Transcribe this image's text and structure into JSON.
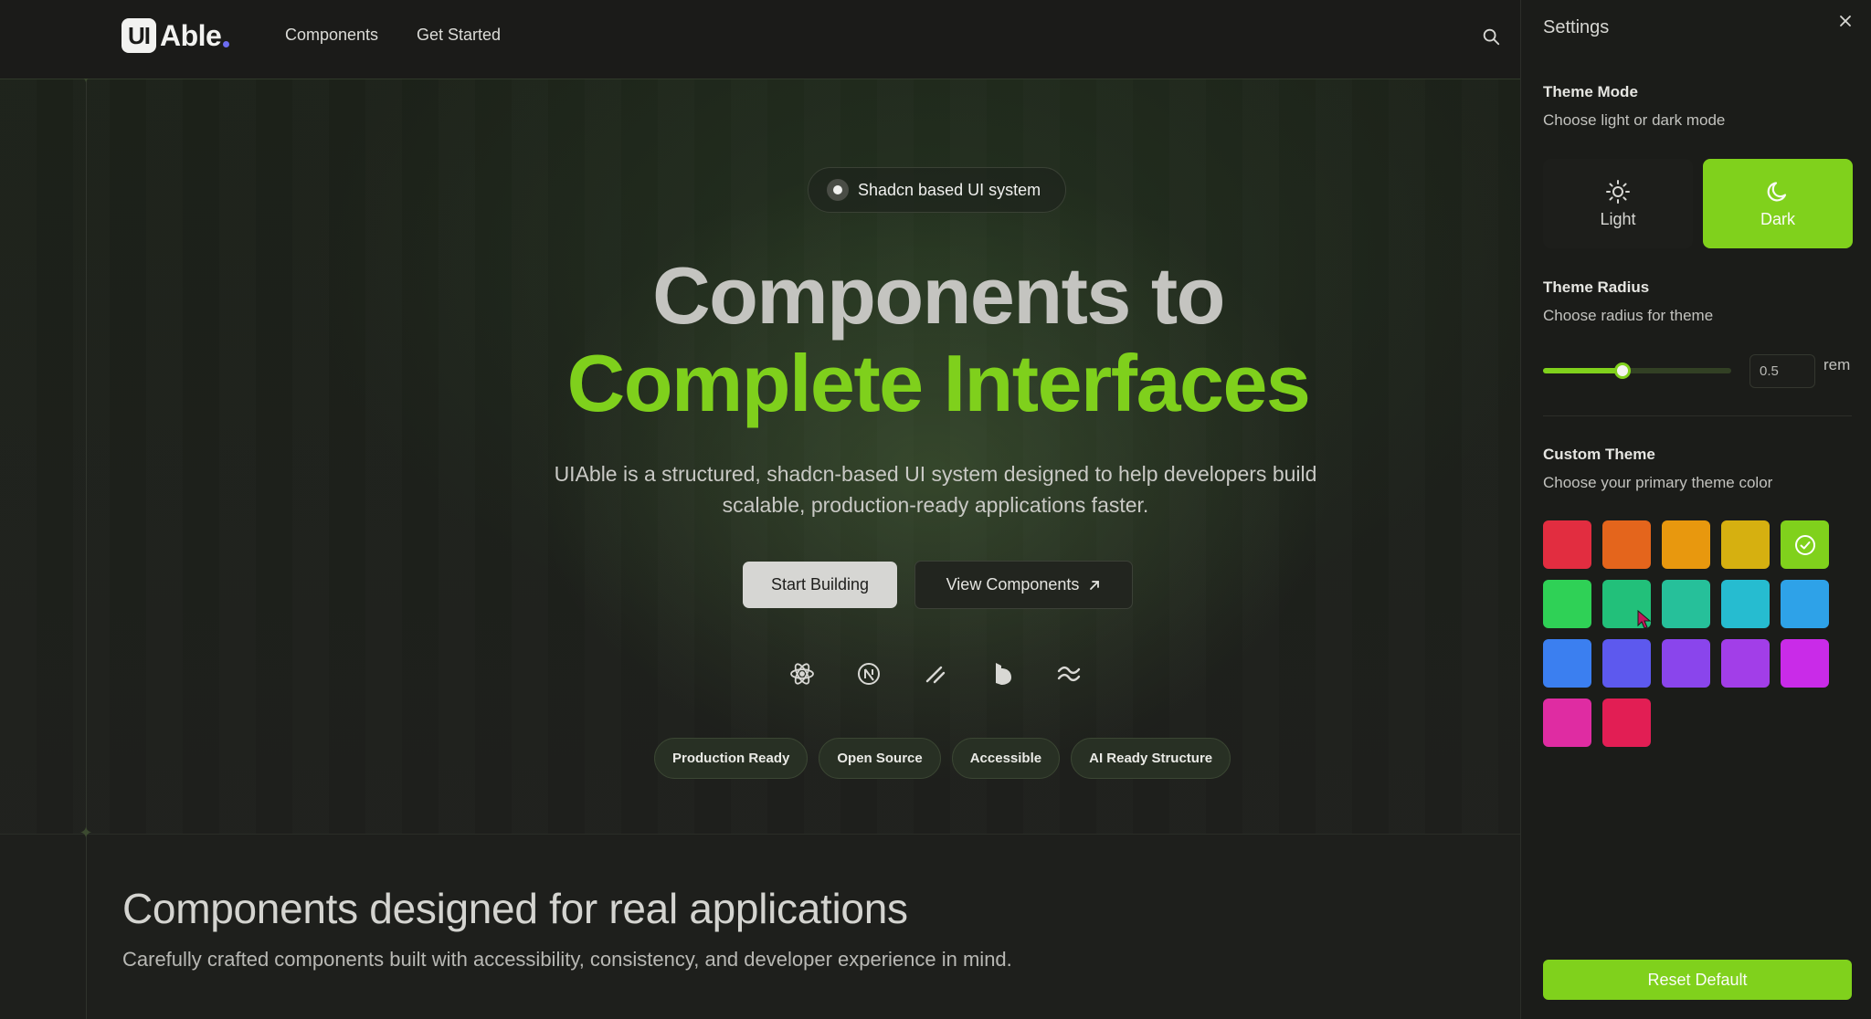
{
  "header": {
    "logo_mark": "UI",
    "logo_text": "Able",
    "nav": [
      "Components",
      "Get Started"
    ]
  },
  "hero": {
    "pill_text": "Shadcn based UI system",
    "title_line1": "Components to",
    "title_line2": "Complete Interfaces",
    "description": "UIAble is a structured, shadcn-based UI system designed to help developers build scalable, production-ready applications faster.",
    "primary_button": "Start Building",
    "secondary_button": "View Components",
    "tech_icons": [
      "react-icon",
      "nextjs-icon",
      "shadcn-icon",
      "bootstrap-like-icon",
      "tailwind-icon"
    ],
    "badges": [
      "Production Ready",
      "Open Source",
      "Accessible",
      "AI Ready Structure"
    ]
  },
  "section": {
    "title": "Components designed for real applications",
    "subtitle": "Carefully crafted components built with accessibility, consistency, and developer experience in mind."
  },
  "settings": {
    "title": "Settings",
    "theme_mode": {
      "heading": "Theme Mode",
      "subtitle": "Choose light or dark mode",
      "options": [
        "Light",
        "Dark"
      ],
      "selected": "Dark"
    },
    "theme_radius": {
      "heading": "Theme Radius",
      "subtitle": "Choose radius for theme",
      "value": "0.5",
      "unit": "rem",
      "slider_fraction": 0.42
    },
    "custom_theme": {
      "heading": "Custom Theme",
      "subtitle": "Choose your primary theme color",
      "colors": [
        "#e22d40",
        "#e4651c",
        "#e8980e",
        "#d6b010",
        "#80d11c",
        "#2fd156",
        "#22c07a",
        "#26c09a",
        "#26bcd0",
        "#2ea2e8",
        "#3b7ff0",
        "#5d59ee",
        "#8a45ec",
        "#a23ee8",
        "#c92be8",
        "#df2ca2",
        "#e21e54"
      ],
      "selected_index": 4
    },
    "reset_button": "Reset Default"
  },
  "colors": {
    "accent": "#80d11c",
    "background": "#1e1f1c"
  }
}
